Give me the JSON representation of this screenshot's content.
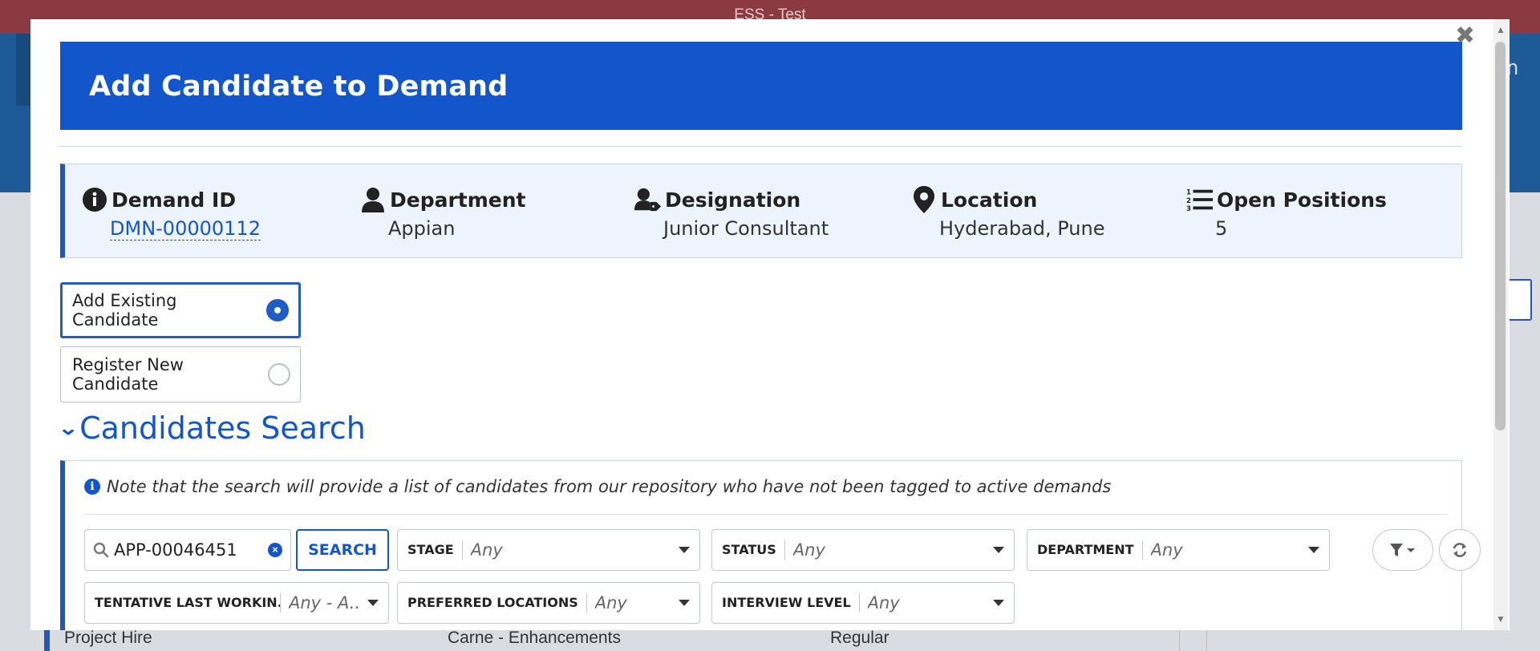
{
  "window": {
    "title": "ESS - Test"
  },
  "background": {
    "user_name_partial": "an",
    "row": {
      "type": "Project Hire",
      "project": "Carne - Enhancements",
      "category": "Regular"
    }
  },
  "modal": {
    "title": "Add Candidate to Demand",
    "info": {
      "demand_id_label": "Demand ID",
      "demand_id_value": "DMN-00000112",
      "department_label": "Department",
      "department_value": "Appian",
      "designation_label": "Designation",
      "designation_value": "Junior Consultant",
      "location_label": "Location",
      "location_value": "Hyderabad, Pune",
      "open_positions_label": "Open Positions",
      "open_positions_value": "5"
    },
    "options": {
      "existing_label": "Add Existing Candidate",
      "new_label": "Register New Candidate",
      "selected": "existing"
    },
    "search_section": {
      "title": "Candidates Search",
      "note": "Note that the search will provide a list of candidates from our repository who have not been tagged to active demands",
      "search_value": "APP-00046451",
      "search_button": "SEARCH",
      "filters": {
        "stage_label": "STAGE",
        "stage_value": "Any",
        "status_label": "STATUS",
        "status_value": "Any",
        "department_label": "DEPARTMENT",
        "department_value": "Any",
        "tentative_label": "TENTATIVE LAST WORKIN...",
        "tentative_value": "Any - A...",
        "preferred_label": "PREFERRED LOCATIONS",
        "preferred_value": "Any",
        "interview_label": "INTERVIEW LEVEL",
        "interview_value": "Any"
      }
    }
  },
  "colors": {
    "accent": "#1356cc",
    "titlebar": "#8a3a40",
    "info_bg": "#edf4fd"
  }
}
